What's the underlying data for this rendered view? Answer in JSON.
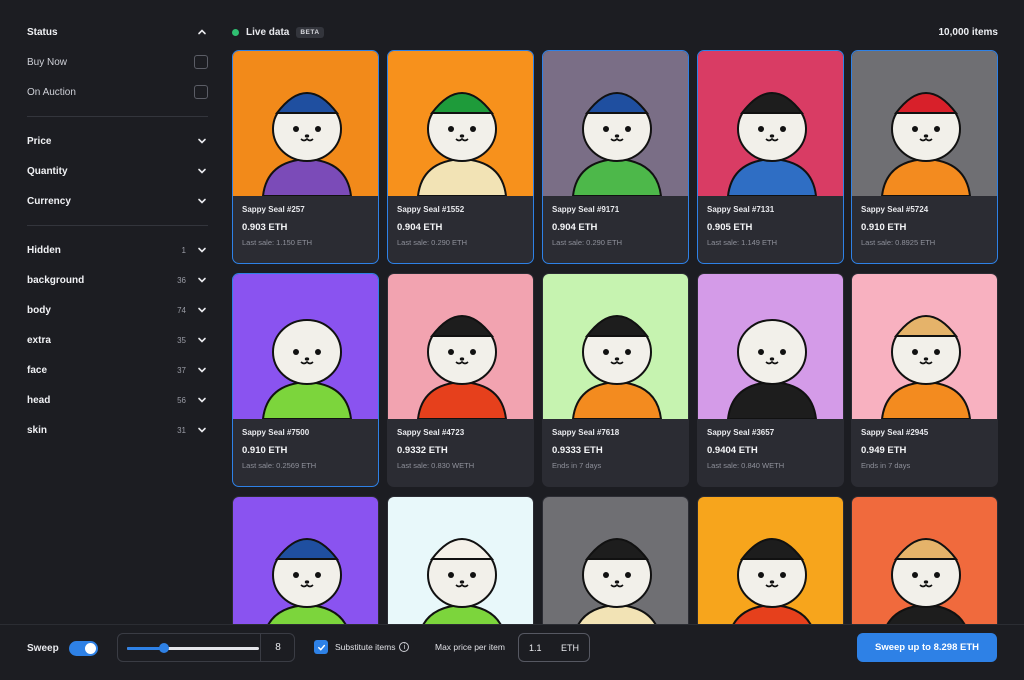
{
  "sidebar": {
    "status": {
      "label": "Status"
    },
    "buy_now": {
      "label": "Buy Now"
    },
    "on_auction": {
      "label": "On Auction"
    },
    "price": {
      "label": "Price"
    },
    "quantity": {
      "label": "Quantity"
    },
    "currency": {
      "label": "Currency"
    },
    "traits": [
      {
        "label": "Hidden",
        "count": "1"
      },
      {
        "label": "background",
        "count": "36"
      },
      {
        "label": "body",
        "count": "74"
      },
      {
        "label": "extra",
        "count": "35"
      },
      {
        "label": "face",
        "count": "37"
      },
      {
        "label": "head",
        "count": "56"
      },
      {
        "label": "skin",
        "count": "31"
      }
    ]
  },
  "header": {
    "live_label": "Live data",
    "beta": "BETA",
    "items_count": "10,000 items"
  },
  "cards": [
    {
      "name": "Sappy Seal #257",
      "price": "0.903 ETH",
      "sub": "Last sale: 1.150 ETH",
      "selected": true,
      "bg": "#f28a1a",
      "hat": "#1f4fa0",
      "outfit": "#7b4bb8"
    },
    {
      "name": "Sappy Seal #1552",
      "price": "0.904 ETH",
      "sub": "Last sale: 0.290 ETH",
      "selected": true,
      "bg": "#f7911c",
      "hat": "#1e9b3a",
      "outfit": "#f2e3b5"
    },
    {
      "name": "Sappy Seal #9171",
      "price": "0.904 ETH",
      "sub": "Last sale: 0.290 ETH",
      "selected": true,
      "bg": "#7a6e86",
      "hat": "#1f4fa0",
      "outfit": "#4db84a"
    },
    {
      "name": "Sappy Seal #7131",
      "price": "0.905 ETH",
      "sub": "Last sale: 1.149 ETH",
      "selected": true,
      "bg": "#d93c64",
      "hat": "#1d1d1d",
      "outfit": "#2f6ec4"
    },
    {
      "name": "Sappy Seal #5724",
      "price": "0.910 ETH",
      "sub": "Last sale: 0.8925 ETH",
      "selected": true,
      "bg": "#6f6f73",
      "hat": "#d8202a",
      "outfit": "#f38b1f"
    },
    {
      "name": "Sappy Seal #7500",
      "price": "0.910 ETH",
      "sub": "Last sale: 0.2569 ETH",
      "selected": true,
      "bg": "#8a53f0",
      "hat": "",
      "outfit": "#7cd53c"
    },
    {
      "name": "Sappy Seal #4723",
      "price": "0.9332 ETH",
      "sub": "Last sale: 0.830 WETH",
      "selected": false,
      "bg": "#f2a3b0",
      "hat": "#1d1d1d",
      "outfit": "#e6401c"
    },
    {
      "name": "Sappy Seal #7618",
      "price": "0.9333 ETH",
      "sub": "Ends in 7 days",
      "selected": false,
      "bg": "#c6f3b0",
      "hat": "#1d1d1d",
      "outfit": "#f38b1f"
    },
    {
      "name": "Sappy Seal #3657",
      "price": "0.9404 ETH",
      "sub": "Last sale: 0.840 WETH",
      "selected": false,
      "bg": "#d49be8",
      "hat": "",
      "outfit": "#1d1d1d"
    },
    {
      "name": "Sappy Seal #2945",
      "price": "0.949 ETH",
      "sub": "Ends in 7 days",
      "selected": false,
      "bg": "#f8b1c0",
      "hat": "#e5b36a",
      "outfit": "#f38b1f"
    },
    {
      "name": "",
      "price": "",
      "sub": "",
      "selected": false,
      "bg": "#8a53f0",
      "hat": "#1f4fa0",
      "outfit": "#7cd53c"
    },
    {
      "name": "",
      "price": "",
      "sub": "",
      "selected": false,
      "bg": "#e8f8fa",
      "hat": "#f4f1e9",
      "outfit": "#7cd53c"
    },
    {
      "name": "",
      "price": "",
      "sub": "",
      "selected": false,
      "bg": "#6f6f73",
      "hat": "#1d1d1d",
      "outfit": "#f2e3b5"
    },
    {
      "name": "",
      "price": "",
      "sub": "",
      "selected": false,
      "bg": "#f7a51c",
      "hat": "#1d1d1d",
      "outfit": "#e6401c"
    },
    {
      "name": "",
      "price": "",
      "sub": "",
      "selected": false,
      "bg": "#f06a3d",
      "hat": "#e5b36a",
      "outfit": "#1d1d1d"
    }
  ],
  "footer": {
    "sweep_label": "Sweep",
    "sweep_enabled": true,
    "slider_value": "8",
    "slider_fraction": 0.28,
    "substitute_label": "Substitute items",
    "substitute_checked": true,
    "max_price_label": "Max price per item",
    "max_price_value": "1.1",
    "max_price_unit": "ETH",
    "sweep_button": "Sweep up to 8.298 ETH"
  },
  "colors": {
    "accent": "#2e81e6",
    "live": "#2fbf71",
    "background": "#1c1d22",
    "card": "#2b2c33"
  }
}
